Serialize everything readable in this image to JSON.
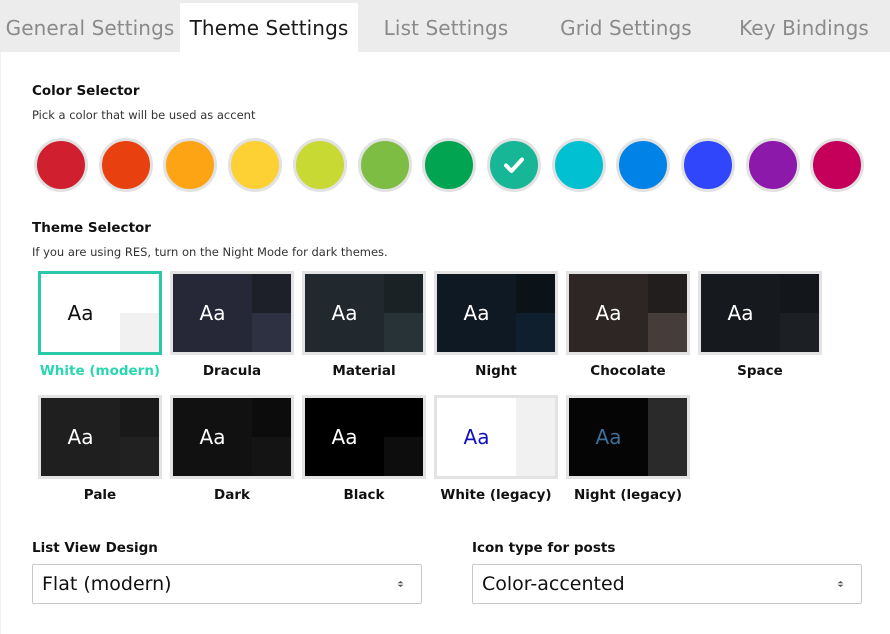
{
  "tabs": [
    {
      "label": "General Settings"
    },
    {
      "label": "Theme Settings"
    },
    {
      "label": "List Settings"
    },
    {
      "label": "Grid Settings"
    },
    {
      "label": "Key Bindings"
    }
  ],
  "active_tab": "Theme Settings",
  "color_selector": {
    "title": "Color Selector",
    "description": "Pick a color that will be used as accent",
    "colors": [
      "#d0202f",
      "#e8400f",
      "#fda414",
      "#fdd034",
      "#c7d932",
      "#7dbd44",
      "#00a451",
      "#17b697",
      "#00c0d2",
      "#0082e6",
      "#2f46fb",
      "#8d19aa",
      "#c4005b"
    ],
    "selected_index": 7
  },
  "theme_selector": {
    "title": "Theme Selector",
    "description": "If you are using RES, turn on the Night Mode for dark themes.",
    "sample_text": "Aa",
    "themes": [
      {
        "name": "White (modern)",
        "main": "#ffffff",
        "top": "#ffffff",
        "bottom": "#f1f1f1",
        "text": "#111111"
      },
      {
        "name": "Dracula",
        "main": "#262837",
        "top": "#1e2029",
        "bottom": "#2d3142",
        "text": "#ffffff"
      },
      {
        "name": "Material",
        "main": "#21292e",
        "top": "#1b2226",
        "bottom": "#283337",
        "text": "#ffffff"
      },
      {
        "name": "Night",
        "main": "#0f1923",
        "top": "#0b1218",
        "bottom": "#0f1f2e",
        "text": "#ffffff"
      },
      {
        "name": "Chocolate",
        "main": "#2d2624",
        "top": "#211e1d",
        "bottom": "#463c39",
        "text": "#ffffff"
      },
      {
        "name": "Space",
        "main": "#16191d",
        "top": "#13161a",
        "bottom": "#1c1f23",
        "text": "#ffffff"
      },
      {
        "name": "Pale",
        "main": "#1f1f1f",
        "top": "#191919",
        "bottom": "#212121",
        "text": "#ffffff"
      },
      {
        "name": "Dark",
        "main": "#111111",
        "top": "#0c0c0c",
        "bottom": "#141414",
        "text": "#ffffff"
      },
      {
        "name": "Black",
        "main": "#000000",
        "top": "#000000",
        "bottom": "#0d0d0d",
        "text": "#ffffff"
      },
      {
        "name": "White (legacy)",
        "main": "#ffffff",
        "top": "#f1f1f1",
        "bottom": "#f1f1f1",
        "text": "#1010c0"
      },
      {
        "name": "Night (legacy)",
        "main": "#050505",
        "top": "#2a2a2a",
        "bottom": "#2a2a2a",
        "text": "#3d6f99"
      }
    ],
    "selected_index": 0,
    "selected_color": "#29d6b0"
  },
  "list_view_design": {
    "label": "List View Design",
    "value": "Flat (modern)"
  },
  "icon_type": {
    "label": "Icon type for posts",
    "value": "Color-accented"
  }
}
